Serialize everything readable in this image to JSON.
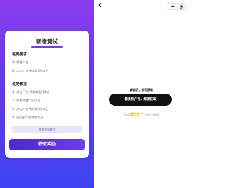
{
  "left_panel": {
    "card_title": "新增测试",
    "requirements": {
      "title": "任务要求",
      "items": [
        {
          "num": "1.",
          "text": "观看广告"
        },
        {
          "num": "2.",
          "text": "点击广告并体验5秒以上"
        }
      ]
    },
    "tutorial": {
      "title": "任务教程",
      "items": [
        {
          "num": "1.",
          "text": "点击下方“获取奖励”按钮"
        },
        {
          "num": "2.",
          "text": "观看完整广告内容"
        },
        {
          "num": "3.",
          "text": "点击广告并体验5秒以上"
        },
        {
          "num": "4.",
          "text": "返回此页面领取奖励"
        }
      ]
    },
    "help_button": "查看视频教程",
    "reward_button": "获取奖励"
  },
  "right_panel": {
    "unlock_tip": "解锁后，即可获取",
    "watch_button": "看视频广告，解锁获取",
    "claimed_prefix": "已有",
    "claimed_count": "899**",
    "claimed_suffix": "位用户解锁",
    "icons": [
      "back-icon",
      "more-icon",
      "close-icon"
    ]
  },
  "colors": {
    "gradient_top": "#8a3ef0",
    "gradient_bottom": "#3f43f2",
    "accent": "#6d3ff2",
    "count_color": "#f2b600",
    "watch_button_bg": "#111111"
  }
}
